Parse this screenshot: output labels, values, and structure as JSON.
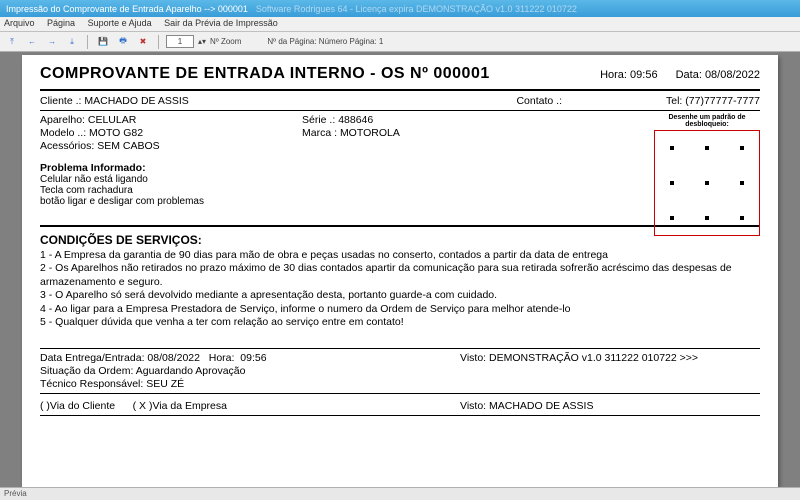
{
  "window": {
    "title": "Impressão do Comprovante de Entrada Aparelho --> 000001",
    "ghost": "Software Rodrigues 64 - Licença expira DEMONSTRAÇÃO v1.0 311222 010722"
  },
  "menu": {
    "arquivo": "Arquivo",
    "pagina": "Página",
    "suporte": "Suporte e Ajuda",
    "sair": "Sair da Prévia de Impressão"
  },
  "toolbar": {
    "zoom_value": "1",
    "zoom_label": "Nº Zoom",
    "page_label": "Nº da Página: Número Página: 1"
  },
  "header": {
    "title": "COMPROVANTE DE ENTRADA INTERNO - OS Nº 000001",
    "hora_label": "Hora:",
    "hora": "09:56",
    "data_label": "Data:",
    "data": "08/08/2022"
  },
  "cliente": {
    "label": "Cliente   .:",
    "nome": "MACHADO DE ASSIS",
    "contato_label": "Contato .:",
    "tel_label": "Tel:",
    "tel": "(77)77777-7777"
  },
  "aparelho": {
    "ap_label": "Aparelho:",
    "ap": "CELULAR",
    "serie_label": "Série .:",
    "serie": "488646",
    "modelo_label": "Modelo ..:",
    "modelo": "MOTO G82",
    "marca_label": "Marca :",
    "marca": "MOTOROLA",
    "acess_label": "Acessórios:",
    "acess": "SEM CABOS",
    "unlock_label": "Desenhe um padrão de desbloqueio:"
  },
  "problema": {
    "titulo": "Problema Informado:",
    "l1": "Celular não está ligando",
    "l2": "Tecla com rachadura",
    "l3": "botão ligar e desligar com problemas"
  },
  "cond": {
    "titulo": "CONDIÇÕES DE SERVIÇOS:",
    "c1": "1 - A Empresa da garantia de 90 dias para mão de obra e peças usadas no conserto, contados  a partir da data de entrega",
    "c2": "2 - Os Aparelhos não retirados no prazo máximo de 30 dias contados apartir da comunicação para sua retirada sofrerão acréscimo das despesas de armazenamento e seguro.",
    "c3": "3 - O Aparelho só será devolvido mediante a apresentação desta, portanto guarde-a com cuidado.",
    "c4": "4 - Ao ligar para a Empresa Prestadora de Serviço, informe o numero da Ordem de Serviço para melhor atende-lo",
    "c5": "5 - Qualquer dúvida que venha a ter com relação ao serviço entre em contato!"
  },
  "footer": {
    "entrega_label": "Data Entrega/Entrada:",
    "entrega": "08/08/2022",
    "hora_label": "Hora:",
    "hora": "09:56",
    "visto1_label": "Visto:",
    "visto1": "DEMONSTRAÇÃO v1.0 311222 010722 >>>",
    "sit_label": "Situação da Ordem:",
    "sit": "Aguardando Aprovação",
    "tec_label": "Técnico Responsável:",
    "tec": "SEU ZÉ",
    "via_cliente": "(    )Via do Cliente",
    "via_empresa": "( X )Via da Empresa",
    "visto2_label": "Visto:",
    "visto2": "MACHADO DE ASSIS"
  },
  "statusbar": {
    "text": "Prévia"
  }
}
